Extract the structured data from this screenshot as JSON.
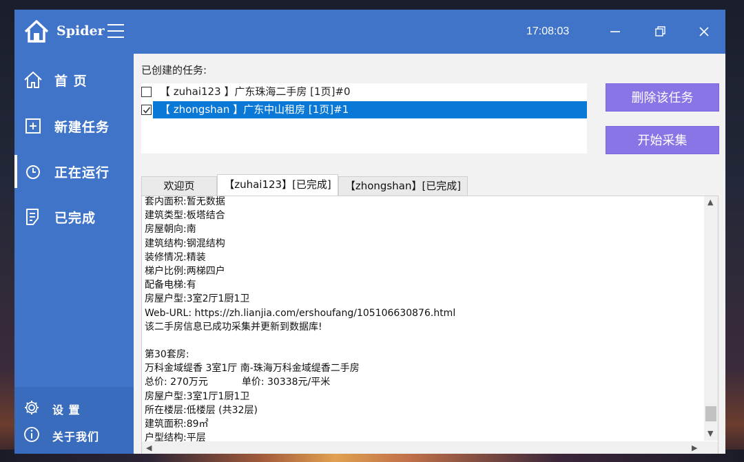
{
  "app": {
    "name": "Spider",
    "time": "17:08:03"
  },
  "sidebar": {
    "items": [
      {
        "label": "首 页",
        "icon": "home-outline-icon"
      },
      {
        "label": "新建任务",
        "icon": "plus-square-icon"
      },
      {
        "label": "正在运行",
        "icon": "clock-icon",
        "active": true
      },
      {
        "label": "已完成",
        "icon": "checklist-icon"
      }
    ],
    "bottom": [
      {
        "label": "设 置",
        "icon": "gear-icon"
      },
      {
        "label": "关于我们",
        "icon": "info-icon"
      }
    ]
  },
  "tasks": {
    "label": "已创建的任务:",
    "items": [
      {
        "text": "【 zuhai123 】广东珠海二手房 [1页]#0",
        "checked": false
      },
      {
        "text": "【 zhongshan 】广东中山租房 [1页]#1",
        "checked": true,
        "selected": true
      }
    ]
  },
  "actions": {
    "delete_label": "删除该任务",
    "start_label": "开始采集"
  },
  "tabs": [
    {
      "label": "欢迎页"
    },
    {
      "label": "【zuhai123】[已完成]",
      "active": true
    },
    {
      "label": "【zhongshan】[已完成]"
    }
  ],
  "log": [
    "套内面积:暂无数据",
    "建筑类型:板塔结合",
    "房屋朝向:南",
    "建筑结构:钢混结构",
    "装修情况:精装",
    "梯户比例:两梯四户",
    "配备电梯:有",
    "房屋户型:3室2厅1厨1卫",
    "Web-URL: https://zh.lianjia.com/ershoufang/105106630876.html",
    "该二手房信息已成功采集并更新到数据库!",
    "",
    "第30套房:",
    "万科金域缇香 3室1厅 南-珠海万科金域缇香二手房",
    "总价: 270万元           单价: 30338元/平米",
    "房屋户型:3室1厅1厨1卫",
    "所在楼层:低楼层 (共32层)",
    "建筑面积:89㎡",
    "户型结构:平层"
  ],
  "colors": {
    "primary": "#3f74c9",
    "selection": "#0a78d7",
    "button": "#8a74e6"
  }
}
